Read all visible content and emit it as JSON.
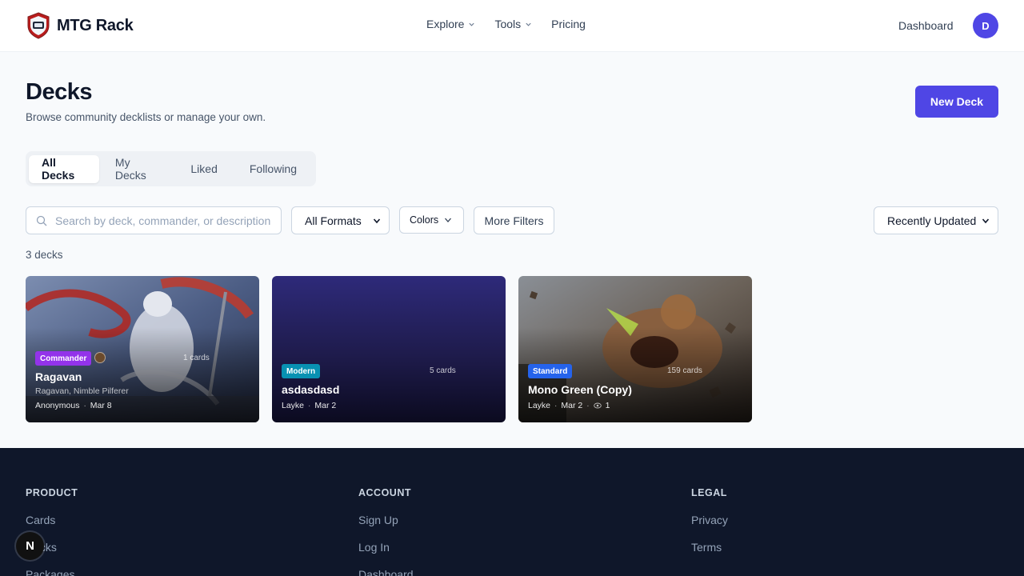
{
  "header": {
    "brand": "MTG Rack",
    "nav": [
      {
        "label": "Explore",
        "has_dropdown": true
      },
      {
        "label": "Tools",
        "has_dropdown": true
      },
      {
        "label": "Pricing",
        "has_dropdown": false
      }
    ],
    "dashboard_label": "Dashboard",
    "avatar_initial": "D"
  },
  "page": {
    "title": "Decks",
    "subtitle": "Browse community decklists or manage your own.",
    "new_deck_label": "New Deck"
  },
  "tabs": [
    {
      "label": "All Decks",
      "active": true
    },
    {
      "label": "My Decks",
      "active": false
    },
    {
      "label": "Liked",
      "active": false
    },
    {
      "label": "Following",
      "active": false
    }
  ],
  "filters": {
    "search_placeholder": "Search by deck, commander, or description...",
    "format_selected": "All Formats",
    "colors_label": "Colors",
    "more_filters_label": "More Filters",
    "sort_selected": "Recently Updated"
  },
  "deck_count": "3 decks",
  "decks": [
    {
      "format": "Commander",
      "format_color": "#9333ea",
      "cards": "1 cards",
      "name": "Ragavan",
      "commander": "Ragavan, Nimble Pilferer",
      "author": "Anonymous",
      "date": "Mar 8"
    },
    {
      "format": "Modern",
      "format_color": "#0891b2",
      "cards": "5 cards",
      "name": "asdasdasd",
      "author": "Layke",
      "date": "Mar 2"
    },
    {
      "format": "Standard",
      "format_color": "#2563eb",
      "cards": "159 cards",
      "name": "Mono Green (Copy)",
      "author": "Layke",
      "date": "Mar 2",
      "views": "1"
    }
  ],
  "footer": {
    "columns": [
      {
        "heading": "PRODUCT",
        "links": [
          "Cards",
          "Decks",
          "Packages"
        ]
      },
      {
        "heading": "ACCOUNT",
        "links": [
          "Sign Up",
          "Log In",
          "Dashboard"
        ]
      },
      {
        "heading": "LEGAL",
        "links": [
          "Privacy",
          "Terms"
        ]
      }
    ]
  },
  "dev_badge": "N",
  "colors": {
    "primary": "#4f46e5",
    "footer_bg": "#0f172a"
  }
}
